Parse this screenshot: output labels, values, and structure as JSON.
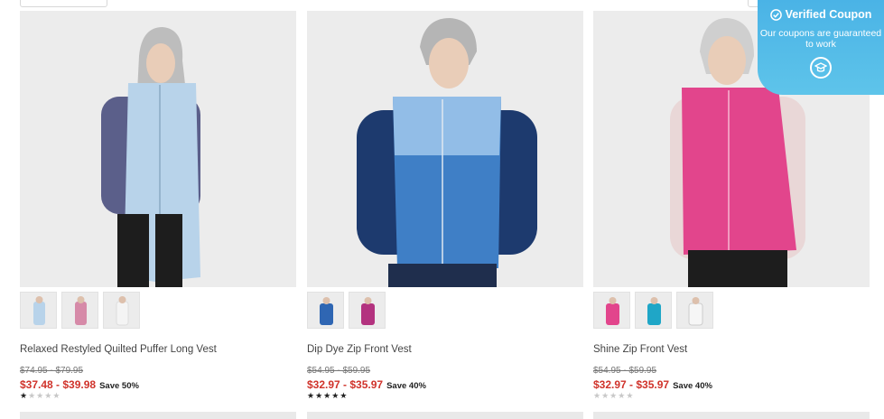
{
  "products": [
    {
      "name": "Relaxed Restyled Quilted Puffer Long Vest",
      "original_price": "$74.95 - $79.95",
      "sale_price": "$37.48 - $39.98",
      "save": "Save 50%",
      "rating": 1,
      "vest_color": "#b8d3ea",
      "top_color": "#5b5f8a",
      "swatches": [
        "#b8d3ea",
        "#d68aa8",
        "#f4f4f4"
      ]
    },
    {
      "name": "Dip Dye Zip Front Vest",
      "original_price": "$54.95 - $59.95",
      "sale_price": "$32.97 - $35.97",
      "save": "Save 40%",
      "rating": 5,
      "vest_color": "#3f7fc6",
      "top_color": "#1d3a6e",
      "swatches": [
        "#2f66b3",
        "#b3337f"
      ]
    },
    {
      "name": "Shine Zip Front Vest",
      "original_price": "$54.95 - $59.95",
      "sale_price": "$32.97 - $35.97",
      "save": "Save 40%",
      "rating": 0,
      "vest_color": "#e2458c",
      "top_color": "#e9d7d7",
      "swatches": [
        "#e2458c",
        "#1fa6c7",
        "#f6f6f6"
      ]
    }
  ],
  "coupon": {
    "title": "Verified Coupon",
    "subtitle": "Our coupons are guaranteed to work",
    "icon": "graduation-cap-icon"
  }
}
